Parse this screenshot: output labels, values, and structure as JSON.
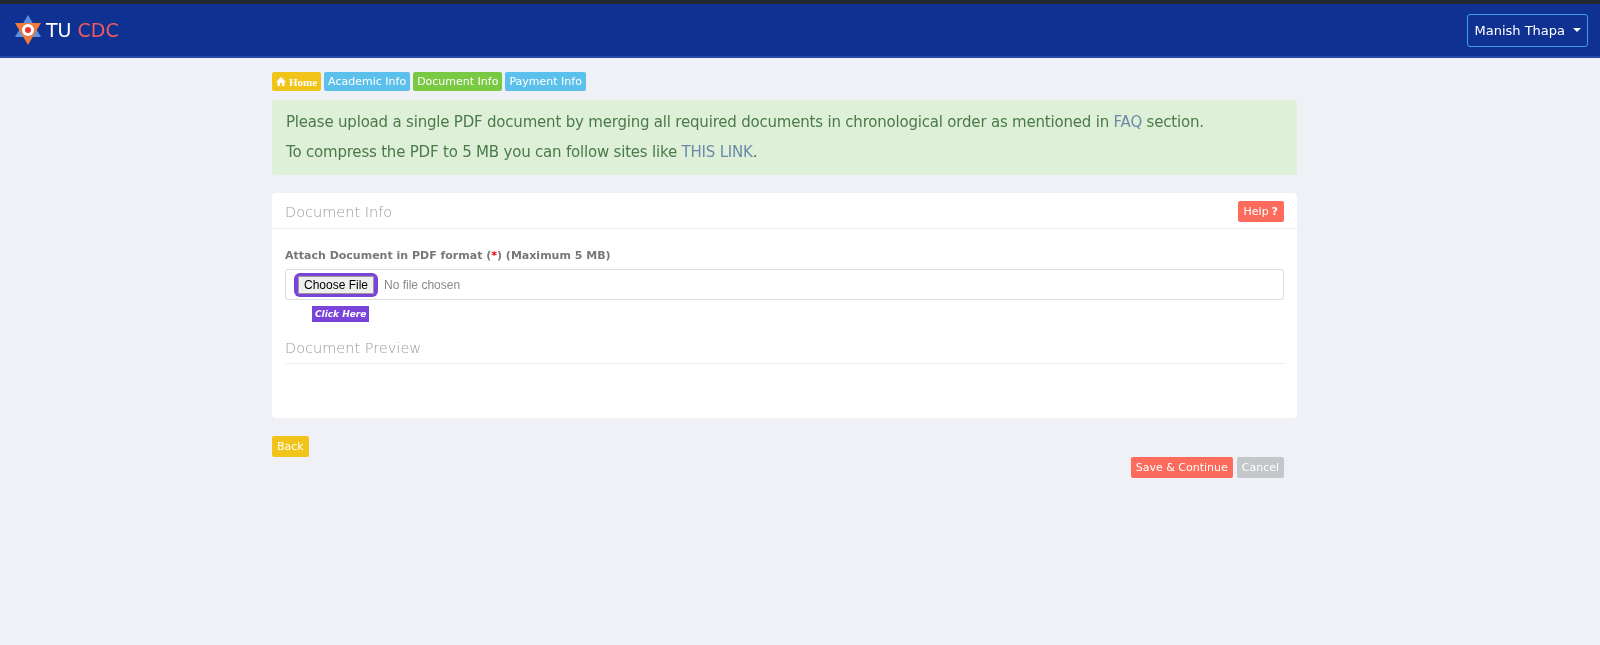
{
  "navbar": {
    "brand_first": "TU",
    "brand_second": "CDC",
    "user_menu": "Manish Thapa"
  },
  "breadcrumbs": [
    {
      "label": "Home",
      "kind": "home",
      "color": "#f0c419"
    },
    {
      "label": "Academic Info",
      "kind": "step",
      "color": "#5bc0eb"
    },
    {
      "label": "Document Info",
      "kind": "step",
      "color": "#7ac943"
    },
    {
      "label": "Payment Info",
      "kind": "step",
      "color": "#5bc0eb"
    }
  ],
  "alert": {
    "lines": [
      {
        "before": "Please upload a single PDF document by merging all required documents in chronological order as mentioned in ",
        "link": "FAQ",
        "after": " section."
      },
      {
        "before": "To compress the PDF to 5 MB you can follow sites like ",
        "link": "THIS LINK",
        "after": "."
      }
    ]
  },
  "panel": {
    "title": "Document Info",
    "help_button": "Help",
    "help_mark": "?",
    "field_label_before": "Attach Document in PDF format (",
    "required_mark": "*",
    "field_label_after": ") (Maximum 5 MB)",
    "file_button": "Choose File",
    "file_status": "No file chosen",
    "hint_tag": "Click Here",
    "preview_title": "Document Preview"
  },
  "buttons": {
    "back": "Back",
    "save": "Save & Continue",
    "cancel": "Cancel"
  }
}
